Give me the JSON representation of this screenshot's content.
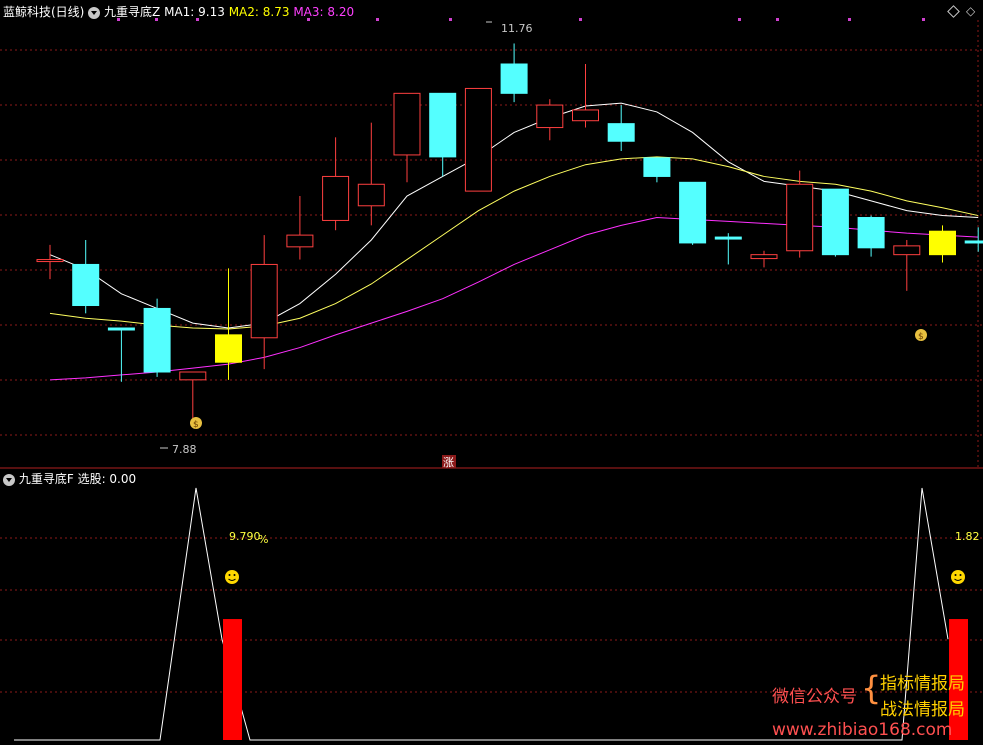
{
  "top_panel": {
    "stock_name": "蓝鲸科技(日线)",
    "indicator_name": "九重寻底Z",
    "ma1_label": "MA1: 9.13",
    "ma2_label": "MA2: 8.73",
    "ma3_label": "MA3: 8.20",
    "high_label": "11.76",
    "low_label": "7.88",
    "zhang_label": "涨"
  },
  "bottom_panel": {
    "indicator_name": "九重寻底F",
    "select_label": "选股: 0.00",
    "value_label_1": "9.790",
    "value_pct": "%",
    "value_label_2": "1.82"
  },
  "watermark": {
    "wechat": "微信公众号",
    "line1": "指标情报局",
    "line2": "战法情报局",
    "url": "www.zhibiao168.com"
  },
  "colors": {
    "up": "#ff4040",
    "down": "#54ffff",
    "signal": "#ffff00",
    "grid": "#8b1a1a",
    "ma1": "#ffffff",
    "ma2": "#ffff60",
    "ma3": "#ff30ff"
  },
  "chart_data": {
    "type": "candlestick",
    "ylim": [
      7.5,
      12.0
    ],
    "candles": [
      {
        "o": 9.55,
        "h": 9.7,
        "l": 9.35,
        "c": 9.55,
        "color": "up"
      },
      {
        "o": 9.5,
        "h": 9.75,
        "l": 9.0,
        "c": 9.08,
        "color": "down"
      },
      {
        "o": 8.85,
        "h": 8.85,
        "l": 8.3,
        "c": 8.85,
        "color": "down"
      },
      {
        "o": 9.05,
        "h": 9.15,
        "l": 8.35,
        "c": 8.4,
        "color": "down"
      },
      {
        "o": 8.32,
        "h": 8.4,
        "l": 7.88,
        "c": 8.4,
        "color": "up"
      },
      {
        "o": 8.5,
        "h": 9.46,
        "l": 8.32,
        "c": 8.78,
        "color": "signal"
      },
      {
        "o": 8.75,
        "h": 9.8,
        "l": 8.43,
        "c": 9.5,
        "color": "up"
      },
      {
        "o": 9.68,
        "h": 10.2,
        "l": 9.55,
        "c": 9.8,
        "color": "up"
      },
      {
        "o": 9.95,
        "h": 10.8,
        "l": 9.85,
        "c": 10.4,
        "color": "up"
      },
      {
        "o": 10.1,
        "h": 10.95,
        "l": 9.9,
        "c": 10.32,
        "color": "up"
      },
      {
        "o": 10.62,
        "h": 11.25,
        "l": 10.34,
        "c": 11.25,
        "color": "up"
      },
      {
        "o": 11.25,
        "h": 11.25,
        "l": 10.4,
        "c": 10.6,
        "color": "down"
      },
      {
        "o": 10.25,
        "h": 11.3,
        "l": 10.25,
        "c": 11.3,
        "color": "up"
      },
      {
        "o": 11.55,
        "h": 11.76,
        "l": 11.16,
        "c": 11.25,
        "color": "down"
      },
      {
        "o": 10.9,
        "h": 11.19,
        "l": 10.77,
        "c": 11.13,
        "color": "up"
      },
      {
        "o": 10.97,
        "h": 11.55,
        "l": 10.9,
        "c": 11.08,
        "color": "up"
      },
      {
        "o": 10.94,
        "h": 11.13,
        "l": 10.66,
        "c": 10.76,
        "color": "down"
      },
      {
        "o": 10.59,
        "h": 10.59,
        "l": 10.34,
        "c": 10.4,
        "color": "down"
      },
      {
        "o": 10.34,
        "h": 10.34,
        "l": 9.7,
        "c": 9.72,
        "color": "down"
      },
      {
        "o": 9.78,
        "h": 9.82,
        "l": 9.5,
        "c": 9.78,
        "color": "down"
      },
      {
        "o": 9.56,
        "h": 9.64,
        "l": 9.47,
        "c": 9.6,
        "color": "up"
      },
      {
        "o": 9.64,
        "h": 10.46,
        "l": 9.57,
        "c": 10.32,
        "color": "up"
      },
      {
        "o": 10.27,
        "h": 10.27,
        "l": 9.58,
        "c": 9.6,
        "color": "down"
      },
      {
        "o": 9.98,
        "h": 10.0,
        "l": 9.58,
        "c": 9.67,
        "color": "down"
      },
      {
        "o": 9.6,
        "h": 9.75,
        "l": 9.23,
        "c": 9.69,
        "color": "up"
      },
      {
        "o": 9.6,
        "h": 9.9,
        "l": 9.52,
        "c": 9.84,
        "color": "signal"
      },
      {
        "o": 9.74,
        "h": 9.88,
        "l": 9.63,
        "c": 9.74,
        "color": "down"
      }
    ],
    "ma1": [
      9.6,
      9.45,
      9.2,
      9.05,
      8.9,
      8.85,
      8.9,
      9.1,
      9.4,
      9.75,
      10.2,
      10.4,
      10.6,
      10.85,
      11.0,
      11.12,
      11.15,
      11.06,
      10.85,
      10.55,
      10.35,
      10.3,
      10.25,
      10.15,
      10.05,
      10.0,
      9.98
    ],
    "ma2": [
      9.0,
      8.95,
      8.92,
      8.88,
      8.85,
      8.84,
      8.87,
      8.95,
      9.1,
      9.3,
      9.55,
      9.8,
      10.05,
      10.25,
      10.4,
      10.52,
      10.58,
      10.6,
      10.58,
      10.5,
      10.4,
      10.35,
      10.32,
      10.25,
      10.15,
      10.08,
      10.0
    ],
    "ma3": [
      8.32,
      8.34,
      8.37,
      8.4,
      8.44,
      8.48,
      8.55,
      8.65,
      8.78,
      8.9,
      9.02,
      9.15,
      9.32,
      9.5,
      9.65,
      9.8,
      9.9,
      9.98,
      9.96,
      9.94,
      9.92,
      9.9,
      9.88,
      9.85,
      9.82,
      9.8,
      9.78
    ],
    "signal_candles": [
      5,
      25
    ],
    "lower": {
      "ylim": [
        0,
        100
      ],
      "line": [
        0,
        0,
        0,
        0,
        100,
        40,
        0,
        0,
        0,
        0,
        0,
        0,
        0,
        0,
        0,
        0,
        0,
        0,
        0,
        0,
        0,
        0,
        0,
        0,
        100,
        40
      ],
      "bars": [
        {
          "index": 5,
          "value": 48
        },
        {
          "index": 25,
          "value": 48
        }
      ]
    }
  }
}
